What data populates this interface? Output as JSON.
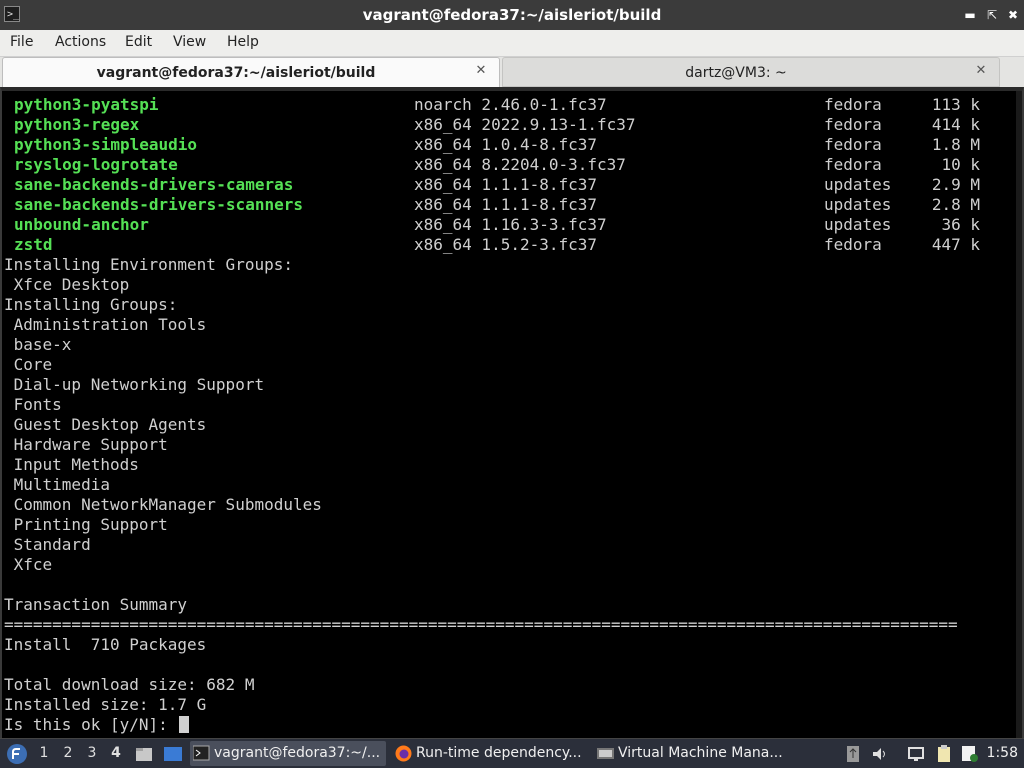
{
  "window": {
    "title": "vagrant@fedora37:~/aisleriot/build",
    "controls": [
      "minimize",
      "maximize",
      "close"
    ]
  },
  "menu": [
    "File",
    "Actions",
    "Edit",
    "View",
    "Help"
  ],
  "tabs": [
    {
      "label": "vagrant@fedora37:~/aisleriot/build",
      "active": true
    },
    {
      "label": "dartz@VM3: ~",
      "active": false
    }
  ],
  "packages": [
    {
      "name": "python3-pyatspi",
      "arch_version": "noarch 2.46.0-1.fc37",
      "repo": "fedora",
      "size": "113 k"
    },
    {
      "name": "python3-regex",
      "arch_version": "x86_64 2022.9.13-1.fc37",
      "repo": "fedora",
      "size": "414 k"
    },
    {
      "name": "python3-simpleaudio",
      "arch_version": "x86_64 1.0.4-8.fc37",
      "repo": "fedora",
      "size": "1.8 M"
    },
    {
      "name": "rsyslog-logrotate",
      "arch_version": "x86_64 8.2204.0-3.fc37",
      "repo": "fedora",
      "size": "10 k"
    },
    {
      "name": "sane-backends-drivers-cameras",
      "arch_version": "x86_64 1.1.1-8.fc37",
      "repo": "updates",
      "size": "2.9 M"
    },
    {
      "name": "sane-backends-drivers-scanners",
      "arch_version": "x86_64 1.1.1-8.fc37",
      "repo": "updates",
      "size": "2.8 M"
    },
    {
      "name": "unbound-anchor",
      "arch_version": "x86_64 1.16.3-3.fc37",
      "repo": "updates",
      "size": "36 k"
    },
    {
      "name": "zstd",
      "arch_version": "x86_64 1.5.2-3.fc37",
      "repo": "fedora",
      "size": "447 k"
    }
  ],
  "lines": [
    "Installing Environment Groups:",
    " Xfce Desktop",
    "Installing Groups:",
    " Administration Tools",
    " base-x",
    " Core",
    " Dial-up Networking Support",
    " Fonts",
    " Guest Desktop Agents",
    " Hardware Support",
    " Input Methods",
    " Multimedia",
    " Common NetworkManager Submodules",
    " Printing Support",
    " Standard",
    " Xfce",
    "",
    "Transaction Summary",
    "===================================================================================================",
    "Install  710 Packages",
    "",
    "Total download size: 682 M",
    "Installed size: 1.7 G"
  ],
  "prompt": "Is this ok [y/N]: ",
  "taskbar": {
    "workspaces": [
      "1",
      "2",
      "3",
      "4"
    ],
    "active_workspace": "4",
    "tasks": [
      {
        "label": "vagrant@fedora37:~/...",
        "icon": "terminal-icon",
        "active": true
      },
      {
        "label": "Run-time dependency...",
        "icon": "firefox-icon",
        "active": false
      },
      {
        "label": "Virtual Machine Mana...",
        "icon": "vmm-icon",
        "active": false
      }
    ],
    "clock": "1:58"
  },
  "colors": {
    "package_name": "#55e055",
    "terminal_bg": "#000000",
    "terminal_fg": "#d0d0d0"
  }
}
